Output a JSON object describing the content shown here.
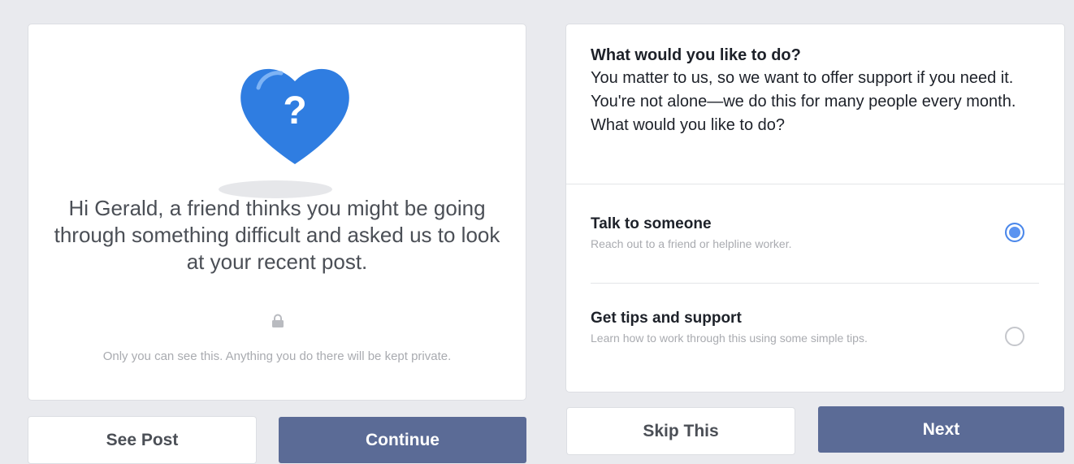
{
  "left": {
    "message": "Hi Gerald, a friend thinks you might be going through something difficult and asked us to look at your recent post.",
    "privacy": "Only you can see this. Anything you do there will be kept private.",
    "heart_glyph": "?",
    "heart_color": "#2f7de1"
  },
  "right": {
    "title": "What would you like to do?",
    "body": "You matter to us, so we want to offer support if you need it. You're not alone—we do this for many people every month. What would you like to do?",
    "options": [
      {
        "title": "Talk to someone",
        "desc": "Reach out to a friend or helpline worker.",
        "selected": true
      },
      {
        "title": "Get tips and support",
        "desc": "Learn how to work through this using some simple tips.",
        "selected": false
      }
    ]
  },
  "buttons": {
    "see_post": "See Post",
    "continue": "Continue",
    "skip": "Skip This",
    "next": "Next"
  },
  "colors": {
    "primary_button": "#5b6b96",
    "radio_selected": "#5b93f0"
  }
}
